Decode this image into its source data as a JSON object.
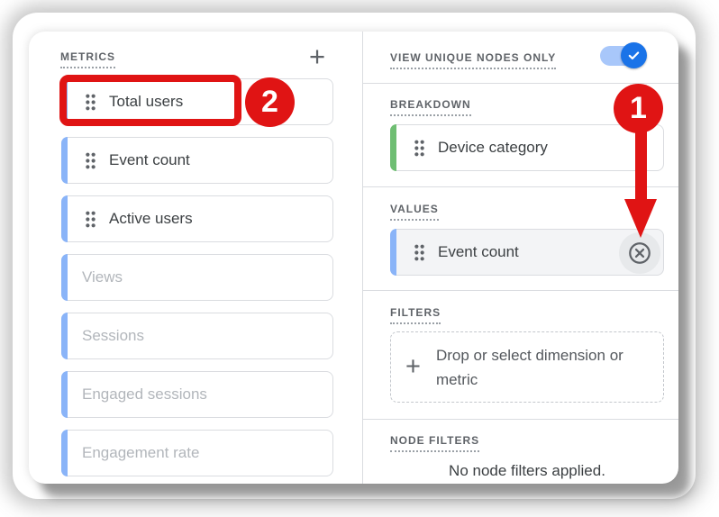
{
  "colors": {
    "red": "#e01414",
    "blue-accent": "#8ab4f8",
    "green-accent": "#6fbe73",
    "toggle-thumb": "#1a73e8",
    "toggle-track": "#a8c7fa",
    "divider": "#dadce0",
    "label-gray": "#5f6368",
    "chip-text": "#3c4043",
    "chip-disabled-text": "#b2b6bb"
  },
  "icons": {
    "plus": "+",
    "drag_handle": "drag-dots",
    "remove": "circle-x",
    "toggle_check": "checkmark"
  },
  "left_panel": {
    "header": {
      "label": "METRICS"
    },
    "metrics": [
      {
        "label": "Total users",
        "state": "active"
      },
      {
        "label": "Event count",
        "state": "active"
      },
      {
        "label": "Active users",
        "state": "active"
      },
      {
        "label": "Views",
        "state": "disabled"
      },
      {
        "label": "Sessions",
        "state": "disabled"
      },
      {
        "label": "Engaged sessions",
        "state": "disabled"
      },
      {
        "label": "Engagement rate",
        "state": "disabled"
      }
    ]
  },
  "right_panel": {
    "unique_nodes": {
      "label": "VIEW UNIQUE NODES ONLY",
      "toggle_on": true
    },
    "breakdown": {
      "label": "BREAKDOWN",
      "chip": {
        "label": "Device category"
      }
    },
    "values": {
      "label": "VALUES",
      "chip": {
        "label": "Event count",
        "removable": true
      }
    },
    "filters": {
      "label": "FILTERS",
      "dropzone_text": "Drop or select dimension or metric"
    },
    "node_filters": {
      "label": "NODE FILTERS",
      "empty_text": "No node filters applied."
    }
  },
  "annotations": {
    "step_1": {
      "label": "1"
    },
    "step_2": {
      "label": "2"
    }
  }
}
